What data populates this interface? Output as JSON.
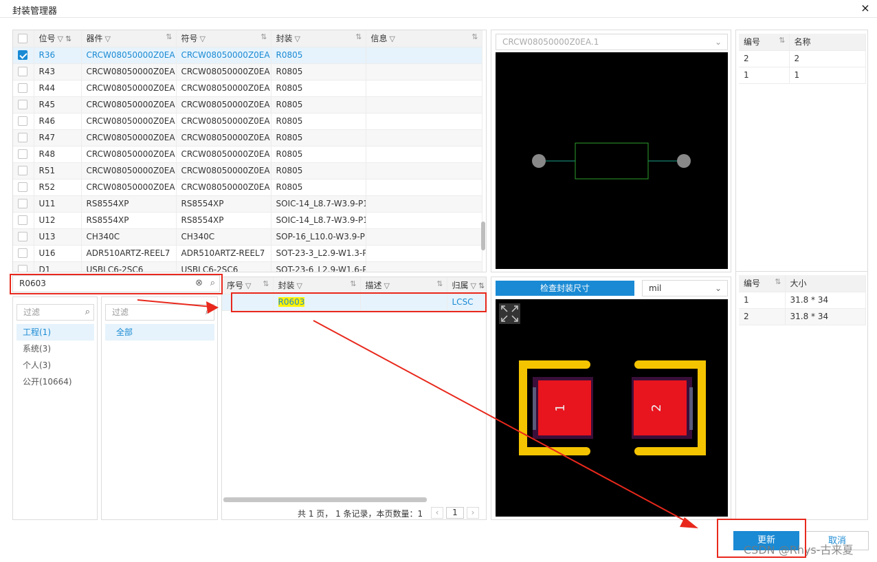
{
  "window": {
    "title": "封装管理器",
    "close": "×"
  },
  "components_table": {
    "headers": [
      "位号",
      "器件",
      "符号",
      "封装",
      "信息"
    ],
    "rows": [
      {
        "ref": "R36",
        "device": "CRCW08050000Z0EA",
        "symbol": "CRCW08050000Z0EA",
        "footprint": "R0805",
        "info": "",
        "checked": true,
        "selected": true
      },
      {
        "ref": "R43",
        "device": "CRCW08050000Z0EA",
        "symbol": "CRCW08050000Z0EA",
        "footprint": "R0805",
        "info": ""
      },
      {
        "ref": "R44",
        "device": "CRCW08050000Z0EA",
        "symbol": "CRCW08050000Z0EA",
        "footprint": "R0805",
        "info": ""
      },
      {
        "ref": "R45",
        "device": "CRCW08050000Z0EA",
        "symbol": "CRCW08050000Z0EA",
        "footprint": "R0805",
        "info": ""
      },
      {
        "ref": "R46",
        "device": "CRCW08050000Z0EA",
        "symbol": "CRCW08050000Z0EA",
        "footprint": "R0805",
        "info": ""
      },
      {
        "ref": "R47",
        "device": "CRCW08050000Z0EA",
        "symbol": "CRCW08050000Z0EA",
        "footprint": "R0805",
        "info": ""
      },
      {
        "ref": "R48",
        "device": "CRCW08050000Z0EA",
        "symbol": "CRCW08050000Z0EA",
        "footprint": "R0805",
        "info": ""
      },
      {
        "ref": "R51",
        "device": "CRCW08050000Z0EA",
        "symbol": "CRCW08050000Z0EA",
        "footprint": "R0805",
        "info": ""
      },
      {
        "ref": "R52",
        "device": "CRCW08050000Z0EA",
        "symbol": "CRCW08050000Z0EA",
        "footprint": "R0805",
        "info": ""
      },
      {
        "ref": "U11",
        "device": "RS8554XP",
        "symbol": "RS8554XP",
        "footprint": "SOIC-14_L8.7-W3.9-P1",
        "info": ""
      },
      {
        "ref": "U12",
        "device": "RS8554XP",
        "symbol": "RS8554XP",
        "footprint": "SOIC-14_L8.7-W3.9-P1",
        "info": ""
      },
      {
        "ref": "U13",
        "device": "CH340C",
        "symbol": "CH340C",
        "footprint": "SOP-16_L10.0-W3.9-P1",
        "info": ""
      },
      {
        "ref": "U16",
        "device": "ADR510ARTZ-REEL7",
        "symbol": "ADR510ARTZ-REEL7",
        "footprint": "SOT-23-3_L2.9-W1.3-P1",
        "info": ""
      },
      {
        "ref": "D1",
        "device": "USBLC6-2SC6",
        "symbol": "USBLC6-2SC6",
        "footprint": "SOT-23-6_L2.9-W1.6-P0",
        "info": ""
      }
    ]
  },
  "symbol_preview": {
    "dropdown_value": "CRCW08050000Z0EA.1"
  },
  "pins_table": {
    "headers": [
      "编号",
      "名称"
    ],
    "rows": [
      {
        "num": "2",
        "name": "2"
      },
      {
        "num": "1",
        "name": "1"
      }
    ]
  },
  "search": {
    "value": "R0603"
  },
  "library_nav": {
    "filter_placeholder": "过滤",
    "items": [
      {
        "label": "工程(1)",
        "selected": true
      },
      {
        "label": "系统(3)"
      },
      {
        "label": "个人(3)"
      },
      {
        "label": "公开(10664)"
      }
    ]
  },
  "category_nav": {
    "filter_placeholder": "过滤",
    "items": [
      {
        "label": "全部",
        "selected": true
      }
    ]
  },
  "footprint_results": {
    "headers": [
      "序号",
      "封装",
      "描述",
      "归属"
    ],
    "rows": [
      {
        "index": "",
        "footprint": "R0603",
        "desc": "",
        "owner": "LCSC"
      }
    ],
    "pagination": {
      "summary": "共 1 页， 1 条记录，本页数量：1",
      "prev": "‹",
      "page": "1",
      "next": "›"
    }
  },
  "footprint_preview": {
    "check_button": "检查封装尺寸",
    "unit": "mil",
    "pad_labels": [
      "1",
      "2"
    ]
  },
  "pads_table": {
    "headers": [
      "编号",
      "大小"
    ],
    "rows": [
      {
        "num": "1",
        "size": "31.8 * 34"
      },
      {
        "num": "2",
        "size": "31.8 * 34"
      }
    ]
  },
  "actions": {
    "update": "更新",
    "cancel": "取消"
  },
  "watermark": "CSDN @Rhys-古来夏",
  "colors": {
    "accent": "#1a8ad4",
    "annotation": "#e8281c",
    "pad": "#e8141e",
    "silkscreen": "#f5c400"
  }
}
